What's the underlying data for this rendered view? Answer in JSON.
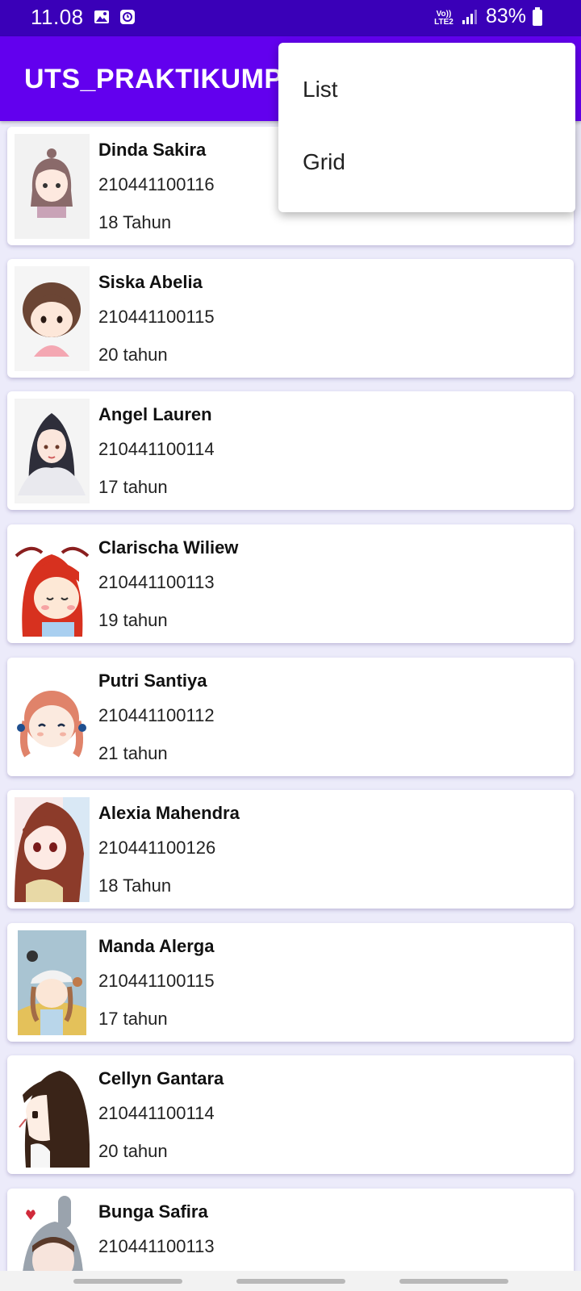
{
  "status_bar": {
    "time": "11.08",
    "network": "Vo)) LTE2",
    "battery": "83%"
  },
  "app_bar": {
    "title": "UTS_PRAKTIKUMPAB"
  },
  "menu": {
    "items": [
      {
        "label": "List"
      },
      {
        "label": "Grid"
      }
    ]
  },
  "students": [
    {
      "name": "Dinda Sakira",
      "nim": "210441100116",
      "age": "18 Tahun",
      "avatar": "avatar-brown-hair-bun"
    },
    {
      "name": "Siska Abelia",
      "nim": "210441100115",
      "age": "20 tahun",
      "avatar": "avatar-bob-hair-pink-shirt"
    },
    {
      "name": "Angel Lauren",
      "nim": "210441100114",
      "age": "17 tahun",
      "avatar": "avatar-long-black-hair"
    },
    {
      "name": "Clarischa Wiliew",
      "nim": "210441100113",
      "age": "19 tahun",
      "avatar": "avatar-red-pigtails"
    },
    {
      "name": "Putri Santiya",
      "nim": "210441100112",
      "age": "21 tahun",
      "avatar": "avatar-orange-braids"
    },
    {
      "name": "Alexia Mahendra",
      "nim": "210441100126",
      "age": "18 Tahun",
      "avatar": "avatar-anime-brown-hair"
    },
    {
      "name": "Manda Alerga",
      "nim": "210441100115",
      "age": "17 tahun",
      "avatar": "avatar-girl-white-cap"
    },
    {
      "name": "Cellyn Gantara",
      "nim": "210441100114",
      "age": "20 tahun",
      "avatar": "avatar-dark-bangs-side"
    },
    {
      "name": "Bunga Safira",
      "nim": "210441100113",
      "age": "",
      "avatar": "avatar-bunny-hood"
    }
  ]
}
